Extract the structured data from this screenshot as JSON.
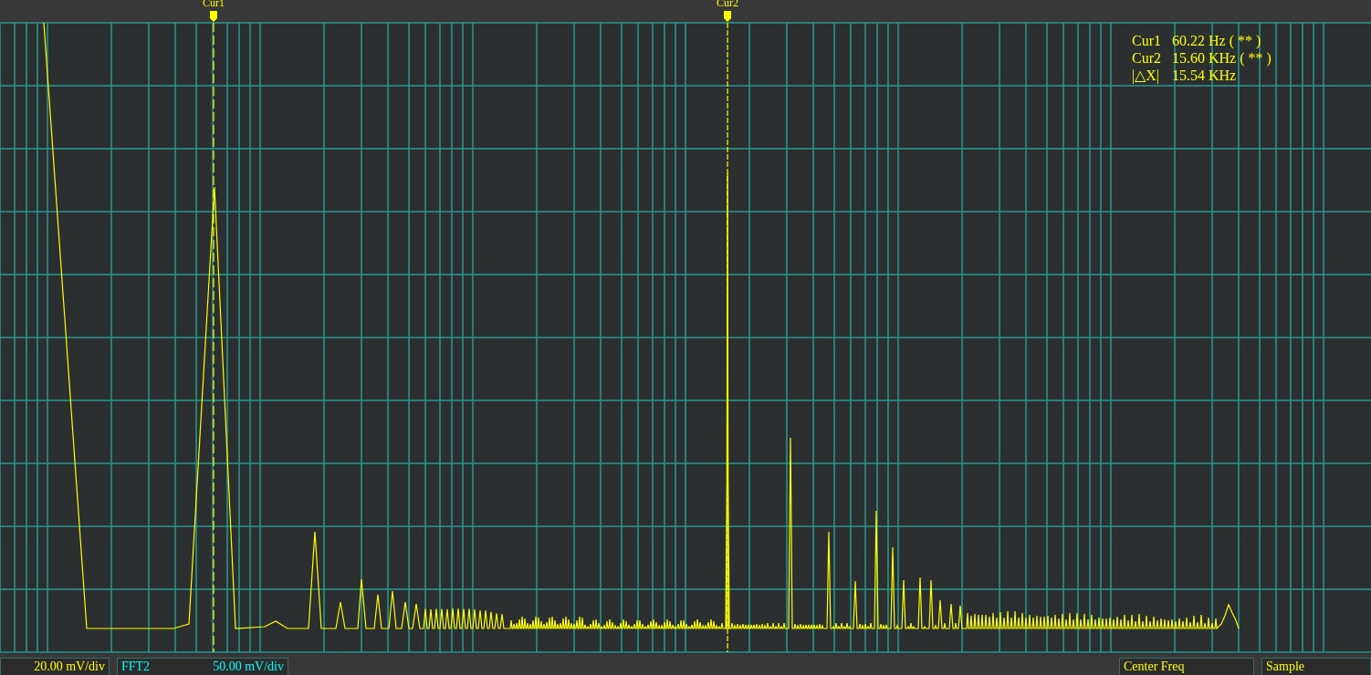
{
  "cursors": [
    {
      "label": "Cur1"
    },
    {
      "label": "Cur2"
    }
  ],
  "readout": [
    {
      "name": "Cur1",
      "value": "60.22 Hz ( ** )"
    },
    {
      "name": "Cur2",
      "value": "15.60 KHz ( ** )"
    },
    {
      "name": "|△X|",
      "value": "15.54 KHz"
    }
  ],
  "channels": [
    {
      "scale": "20.00 mV/div",
      "color": "#ffff00"
    },
    {
      "name": "FFT2",
      "scale": "50.00 mV/div",
      "color": "#00ffff"
    }
  ],
  "panels": [
    {
      "label": "Center Freq"
    },
    {
      "label": "Sample"
    }
  ]
}
